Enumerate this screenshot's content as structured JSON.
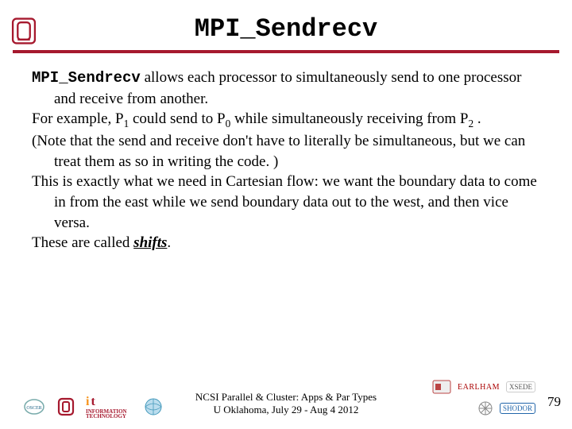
{
  "title": "MPI_Sendrecv",
  "body": {
    "p1_code": "MPI_Sendrecv",
    "p1_rest": " allows each processor to simultaneously send to one processor and receive from another.",
    "p2_a": "For example, P",
    "p2_s1": "1",
    "p2_b": " could send to P",
    "p2_s0": "0",
    "p2_c": " while simultaneously receiving from P",
    "p2_s2": "2",
    "p2_d": " .",
    "p3": "(Note that the send and receive don't have to literally be simultaneous, but we can treat them as so in writing the code. )",
    "p4": "This is exactly what we need in Cartesian flow: we want the boundary data to come in from the east while we send boundary data out to the west, and then vice versa.",
    "p5_a": "These are called ",
    "p5_b": "shifts",
    "p5_c": "."
  },
  "footer": {
    "line1": "NCSI Parallel & Cluster: Apps & Par Types",
    "line2": "U Oklahoma, July 29 - Aug 4 2012",
    "page": "79"
  },
  "logos": {
    "ou_letters": "OU",
    "oscer": "OSCER",
    "it1": "INFORMATION",
    "it2": "TECHNOLOGY",
    "globe": "🌐",
    "xsede": "XSEDE",
    "earlham": "EARLHAM",
    "shodor": "SHODOR"
  }
}
